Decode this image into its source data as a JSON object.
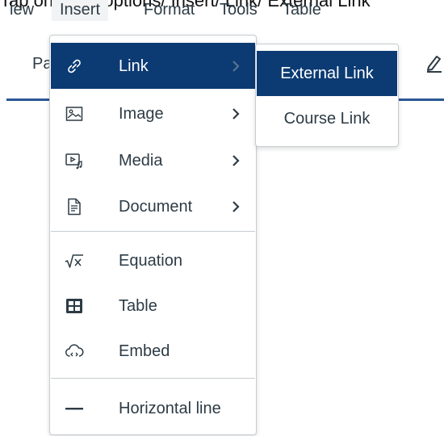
{
  "caption": {
    "text": "Tap on more options/ Insert/ Link/ External Link"
  },
  "menubar": {
    "items": [
      {
        "label": "iew"
      },
      {
        "label": "Insert"
      },
      {
        "label": "Format"
      },
      {
        "label": "Tools"
      },
      {
        "label": "Table"
      }
    ]
  },
  "toolbar": {
    "paragraph_text": "Pa"
  },
  "insert_menu": {
    "items": [
      {
        "label": "Link",
        "icon": "link-icon",
        "has_submenu": true,
        "highlighted": true
      },
      {
        "label": "Image",
        "icon": "image-icon",
        "has_submenu": true
      },
      {
        "label": "Media",
        "icon": "media-icon",
        "has_submenu": true
      },
      {
        "label": "Document",
        "icon": "document-icon",
        "has_submenu": true
      },
      {
        "label": "Equation",
        "icon": "equation-icon",
        "has_submenu": false
      },
      {
        "label": "Table",
        "icon": "table-icon",
        "has_submenu": false
      },
      {
        "label": "Embed",
        "icon": "embed-icon",
        "has_submenu": false
      },
      {
        "label": "Horizontal line",
        "icon": "horizontal-line-icon",
        "has_submenu": false
      }
    ]
  },
  "link_submenu": {
    "items": [
      {
        "label": "External Link",
        "highlighted": true
      },
      {
        "label": "Course Link"
      }
    ]
  },
  "colors": {
    "highlight": "#0c3b73",
    "text": "#2d3b45",
    "border": "#c7cdd1",
    "accent_line": "#2b5797"
  }
}
